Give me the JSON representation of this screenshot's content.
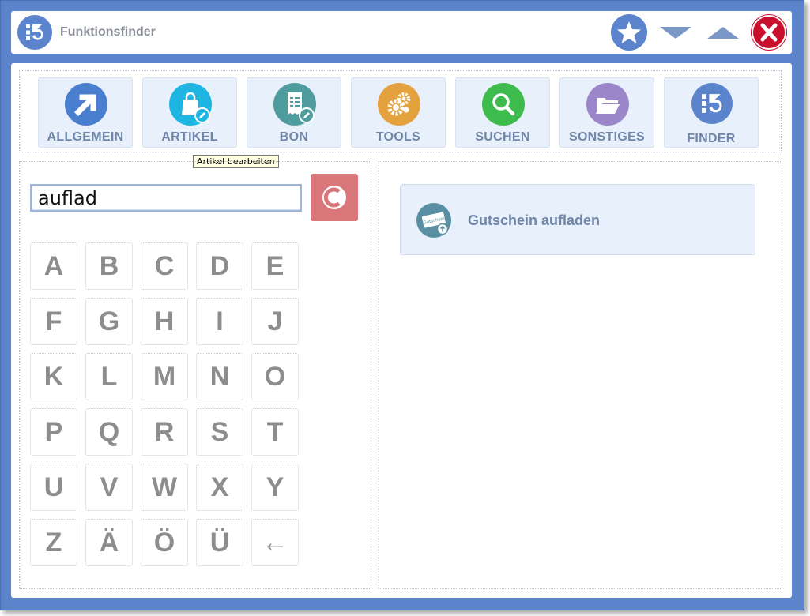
{
  "window": {
    "title": "Funktionsfinder"
  },
  "toolbar": {
    "items": [
      {
        "key": "allgemein",
        "label": "ALLGEMEIN",
        "icon": "arrow-up-right-icon",
        "color": "#4a7fcf"
      },
      {
        "key": "artikel",
        "label": "ARTIKEL",
        "icon": "shopping-bag-edit-icon",
        "color": "#1fb5e3"
      },
      {
        "key": "bon",
        "label": "BON",
        "icon": "receipt-edit-icon",
        "color": "#4e9c9e"
      },
      {
        "key": "tools",
        "label": "TOOLS",
        "icon": "gears-icon",
        "color": "#e3a23e"
      },
      {
        "key": "suchen",
        "label": "SUCHEN",
        "icon": "magnifier-icon",
        "color": "#3dbb4d"
      },
      {
        "key": "sonstiges",
        "label": "SONSTIGES",
        "icon": "folder-icon",
        "color": "#9a86c9"
      },
      {
        "key": "finder",
        "label": "FINDER",
        "icon": "finder-logo-icon",
        "color": "#5b84cd"
      }
    ]
  },
  "tooltip": {
    "text": "Artikel bearbeiten"
  },
  "search": {
    "value": "auflad"
  },
  "keyboard": {
    "rows": [
      [
        "A",
        "B",
        "C",
        "D",
        "E"
      ],
      [
        "F",
        "G",
        "H",
        "I",
        "J"
      ],
      [
        "K",
        "L",
        "M",
        "N",
        "O"
      ],
      [
        "P",
        "Q",
        "R",
        "S",
        "T"
      ],
      [
        "U",
        "V",
        "W",
        "X",
        "Y"
      ],
      [
        "Z",
        "Ä",
        "Ö",
        "Ü",
        "←"
      ]
    ]
  },
  "results": [
    {
      "label": "Gutschein aufladen",
      "icon_text": "Gutschein"
    }
  ]
}
